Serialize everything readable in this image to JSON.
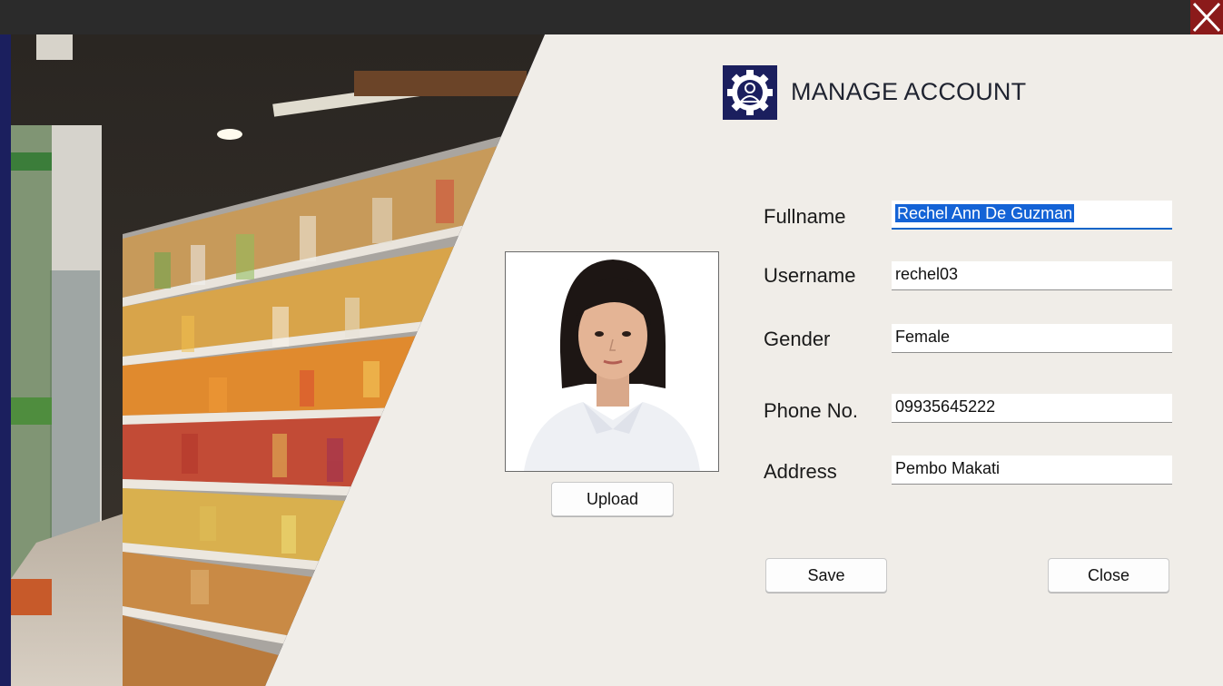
{
  "window": {
    "close_icon": "close-x-icon",
    "close_color": "#8b1a1a"
  },
  "header": {
    "title": "MANAGE ACCOUNT",
    "logo_icon": "user-gear-icon",
    "accent": "#1b1f5e"
  },
  "profile": {
    "photo_icon": "user-portrait-photo",
    "upload_label": "Upload"
  },
  "form": {
    "fullname": {
      "label": "Fullname",
      "value": "Rechel Ann De Guzman"
    },
    "username": {
      "label": "Username",
      "value": "rechel03"
    },
    "gender": {
      "label": "Gender",
      "value": "Female"
    },
    "phone": {
      "label": "Phone No.",
      "value": "09935645222"
    },
    "address": {
      "label": "Address",
      "value": "Pembo Makati"
    }
  },
  "actions": {
    "save_label": "Save",
    "close_label": "Close"
  },
  "decor": {
    "background_image": "supermarket-aisle-photo"
  }
}
